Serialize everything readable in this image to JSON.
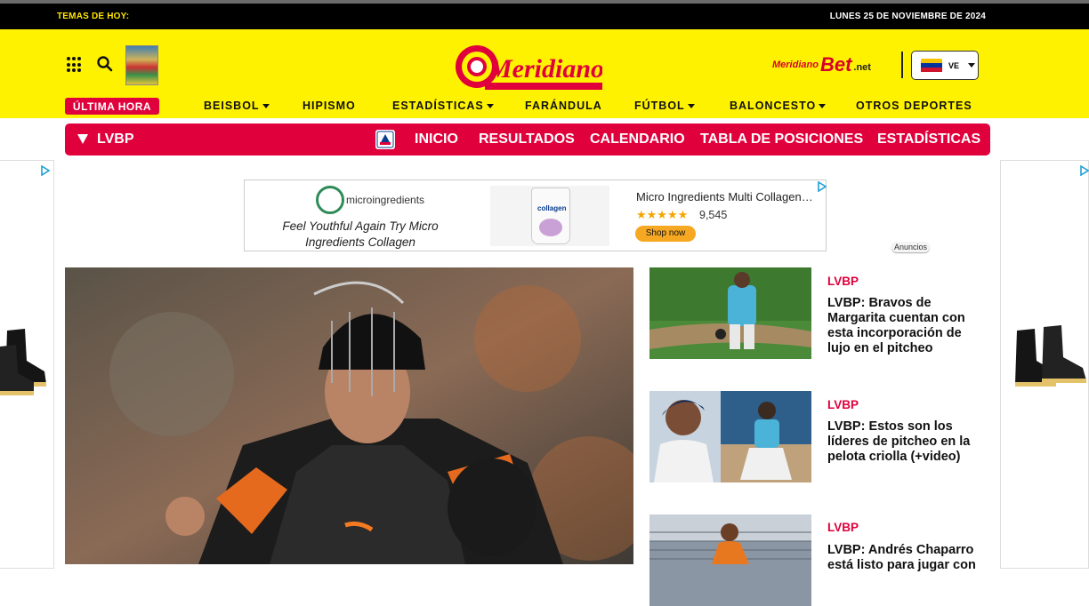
{
  "topbar": {
    "temas_label": "TEMAS DE HOY:",
    "date": "LUNES 25 DE NOVIEMBRE DE 2024"
  },
  "header": {
    "logo_text": "Meridiano",
    "bet_brand": "Meridiano",
    "bet_word": "Bet",
    "bet_tld": ".net",
    "country_code": "VE",
    "flag_colors": [
      "#f5c400",
      "#0033a0",
      "#cf142b"
    ]
  },
  "nav": {
    "breaking": "ÚLTIMA HORA",
    "items": [
      {
        "label": "BEISBOL",
        "dropdown": true
      },
      {
        "label": "HIPISMO",
        "dropdown": false
      },
      {
        "label": "ESTADÍSTICAS",
        "dropdown": true
      },
      {
        "label": "FARÁNDULA",
        "dropdown": false
      },
      {
        "label": "FÚTBOL",
        "dropdown": true
      },
      {
        "label": "BALONCESTO",
        "dropdown": true
      },
      {
        "label": "OTROS DEPORTES",
        "dropdown": false
      }
    ]
  },
  "section_bar": {
    "label": "LVBP",
    "links": [
      "INICIO",
      "RESULTADOS",
      "CALENDARIO",
      "TABLA DE POSICIONES",
      "ESTADÍSTICAS"
    ]
  },
  "ad": {
    "brand": "microingredients",
    "tagline": "Feel Youthful Again Try Micro Ingredients Collagen",
    "product_title": "Micro Ingredients Multi Collagen…",
    "stars": "★★★★★",
    "review_count": "9,545",
    "cta": "Shop now",
    "bag_label": "collagen",
    "disclosure": "Anuncios"
  },
  "articles": [
    {
      "category": "LVBP",
      "title": "LVBP: Bravos de Margarita cuentan con esta incorporación de lujo en el pitcheo"
    },
    {
      "category": "LVBP",
      "title": "LVBP: Estos son los líderes de pitcheo en la pelota criolla (+video)"
    },
    {
      "category": "LVBP",
      "title": "LVBP: Andrés Chaparro está listo para jugar con"
    }
  ],
  "colors": {
    "brand_yellow": "#fff200",
    "brand_red": "#e0003c",
    "topbar_black": "#000000"
  }
}
